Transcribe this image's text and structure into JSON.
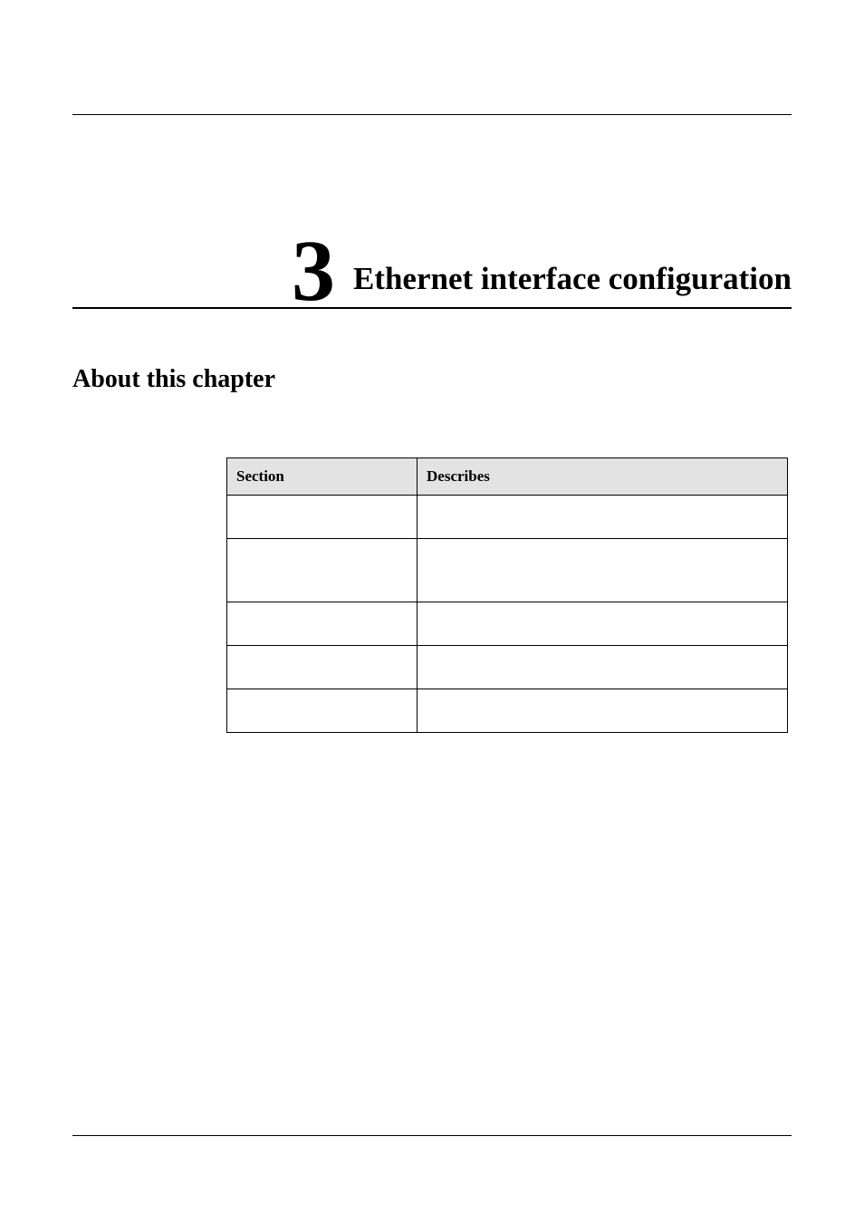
{
  "chapter": {
    "number": "3",
    "title": "Ethernet interface configuration"
  },
  "about_heading": "About this chapter",
  "table": {
    "headers": {
      "section": "Section",
      "describes": "Describes"
    },
    "rows": [
      {
        "section": "",
        "describes": ""
      },
      {
        "section": "",
        "describes": ""
      },
      {
        "section": "",
        "describes": ""
      },
      {
        "section": "",
        "describes": ""
      },
      {
        "section": "",
        "describes": ""
      }
    ]
  }
}
